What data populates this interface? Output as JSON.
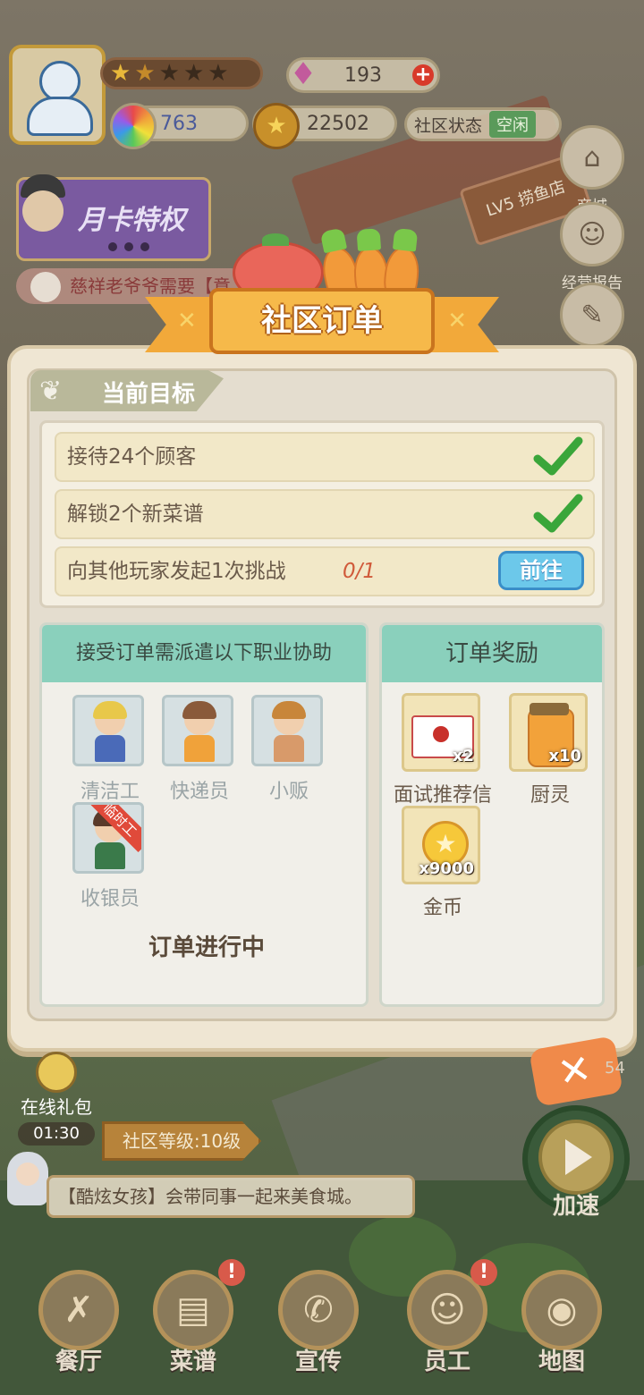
{
  "hud": {
    "gems": "193",
    "rainbow": "763",
    "coins": "22502",
    "status_label": "社区状态",
    "status_value": "空闲",
    "stars_total": 5,
    "stars_filled": 1.5,
    "month_card": "月卡特权",
    "ticker": "慈祥老爷爷需要【意",
    "restaurant_sign": "LV5 捞鱼店"
  },
  "side_buttons": {
    "shop": "商城",
    "report": "经营报告",
    "checkin": "签到"
  },
  "modal": {
    "title": "社区订单",
    "target_tab": "当前目标",
    "tasks": [
      {
        "text": "接待24个顾客",
        "done": true
      },
      {
        "text": "解锁2个新菜谱",
        "done": true
      },
      {
        "text": "向其他玩家发起1次挑战",
        "progress": "0/1",
        "button": "前往"
      }
    ],
    "jobs_header": "接受订单需派遣以下职业协助",
    "jobs": [
      {
        "name": "清洁工"
      },
      {
        "name": "快递员"
      },
      {
        "name": "小贩"
      },
      {
        "name": "收银员",
        "ribbon": "临时工"
      }
    ],
    "order_status": "订单进行中",
    "rewards_header": "订单奖励",
    "rewards": [
      {
        "name": "面试推荐信",
        "qty": "x2"
      },
      {
        "name": "厨灵",
        "qty": "x10"
      },
      {
        "name": "金币",
        "qty": "x9000"
      }
    ]
  },
  "bottom": {
    "gift_label": "在线礼包",
    "gift_timer": "01:30",
    "community_level": "社区等级:10级",
    "announcement": "【酷炫女孩】会带同事一起来美食城。",
    "speed_label": "加速",
    "counter": "54",
    "nav": [
      "餐厅",
      "菜谱",
      "宣传",
      "员工",
      "地图"
    ]
  },
  "colors": {
    "accent_orange": "#f2a93a",
    "teal_header": "#8ad0bc",
    "check_green": "#3aa63a",
    "go_button": "#6cc8ea"
  }
}
